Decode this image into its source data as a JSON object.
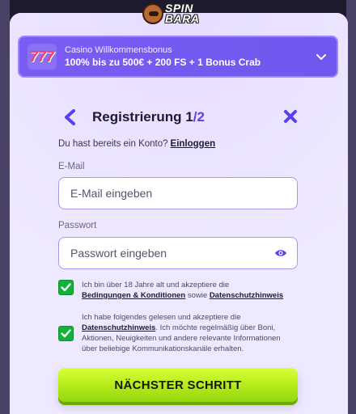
{
  "logo": {
    "line1": "SPIN",
    "line2": "BARA"
  },
  "bonus": {
    "badge": "777",
    "title": "Casino Willkommensbonus",
    "description": "100% bis zu 500€ + 200 FS + 1 Bonus Crab"
  },
  "header": {
    "title": "Registrierung",
    "step_current": "1",
    "step_separator": "/",
    "step_total": "2"
  },
  "login": {
    "prompt": "Du hast bereits ein Konto?",
    "link": "Einloggen"
  },
  "email": {
    "label": "E-Mail",
    "placeholder": "E-Mail eingeben",
    "value": ""
  },
  "password": {
    "label": "Passwort",
    "placeholder": "Passwort eingeben",
    "value": ""
  },
  "consent_terms": {
    "checked": true,
    "text_before": "Ich bin über 18 Jahre alt und akzeptiere die",
    "link_terms": "Bedingungen & Konditionen",
    "text_mid": "sowie",
    "link_privacy": "Datenschutzhinweis"
  },
  "consent_marketing": {
    "checked": true,
    "text_before": "Ich habe folgendes gelesen und akzeptiere die",
    "link_privacy": "Datenschutzhinweis",
    "text_after": ". Ich möchte regelmäßig über Boni, Aktionen, Neuigkeiten und andere relevante Informationen über beliebige Kommunikationskanäle erhalten."
  },
  "next_button": {
    "label": "NÄCHSTER SCHRITT"
  },
  "colors": {
    "accent": "#5a3ff0",
    "bonus_bg": "#7b5cf2",
    "checkbox": "#12b23a",
    "cta": "#b5ec1a",
    "modal_bg": "#efe9ff"
  }
}
